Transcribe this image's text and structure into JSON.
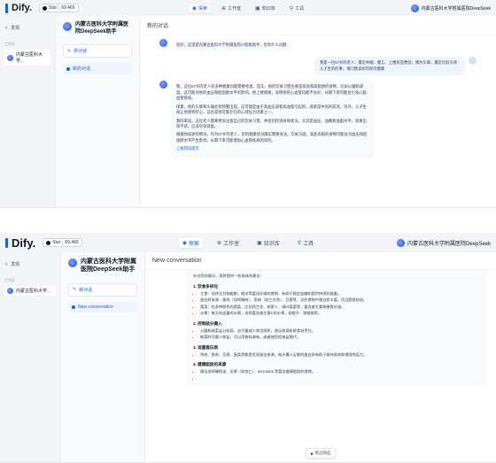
{
  "brand": "Dify.",
  "github": {
    "label": "Star",
    "count": "69,469"
  },
  "nav": [
    {
      "label": "探索",
      "icon": "explore-icon"
    },
    {
      "label": "工作室",
      "icon": "studio-icon"
    },
    {
      "label": "知识库",
      "icon": "knowledge-icon"
    },
    {
      "label": "工具",
      "icon": "tools-icon"
    }
  ],
  "user_name": "内蒙古医科大学附属医院DeepSeek",
  "sidebar": {
    "explore": "发现",
    "workspace_section": "工作区",
    "workspace_item_short": "内蒙古医科大学...",
    "workspace_item": "内蒙古医科大学..."
  },
  "app_name": "内蒙古医科大学附属医院DeepSeek助手",
  "new_chat": "新对话",
  "conv_cn": "新的对话",
  "conv_en": "New conversation",
  "title_cn": "新的对话",
  "title_en": "New conversation",
  "chat": {
    "greeting": "您好，这里是内蒙古医科大学附属医院AI智能助手，您有什么问题",
    "user_msg": "我是一位67岁的老人，最近失眠、健忘、上楼有些费劲，偶尔头晕，最近比较头疼儿子生的的事，请问我该如何保持健康",
    "reply_p1": "嗯，这位67岁的老人有多种健康问题需要考虑。首先，他的饮食习惯主要是高盐和高脂肪的食物，比如火腿和咸菜。这可能对他的血压和胆固醇水平有影响。他上楼困难，说明他的心血管功能不太好，长期下来可能会引发心脑血管疾病。",
    "reply_p2": "接着，他的头晕和头痛症状频繁出现，这可能是由于高血压或者高血脂引起的，或者是中风的前兆。另外，儿子生病让他感到担心，这也是他可能存在的心理压力因素之一。",
    "reply_p3": "我的来说，这位老人需要更加注意自己的饮食习惯，并密切检测身体状况，尤其是血压、血糖和血脂水平。如果出现不适，应该尽早就医。",
    "reply_p4": "根据你描述的情况，作为67岁的老人，您的健康状况确实需要关注。饮食方面，高盐高脂的食物可能会对血压和胆固醇水平产生影响，长期下来可能增加心血管疾病的风险。",
    "reply_more": "上报错误提示",
    "long_intro": "针对您的情况，我将提供一些具体的建议：",
    "sec1": "1. 饮食多样化",
    "sec1_items": [
      "主食：选择全谷物粗粮，糙米等富含纤维的食物，有助于稳定血糖和提供持续的能量。",
      "蛋白质来源：瘦肉（如鸡胸肉）、鱼肉（如三文鱼）、豆腐等，这些食物中蛋白质丰富，而且脂肪较低。",
      "蔬菜：吃多种颜色的蔬菜，比如西兰花、胡萝卜、绿叶蔬菜等，富含维生素和膳食纤维。",
      "水果：每天吃适量的水果，选择富含维生素C的水果，如橙子、猕猴桃等。"
    ],
    "sec2": "2. 控制盐分摄入",
    "sec2_items": [
      "火腿和咸菜盐分较高，应尽量减少食用频率，建议改用新鲜食材烹饪。",
      "做菜时尽量少放盐，可以用香料调味，或者使用低钠盐替代。"
    ],
    "sec3": "3. 适量蛋白质",
    "sec3_items": [
      "鸡肉、鱼肉、豆腐、蛋类等都是优质蛋白来源，每天摄入足够的蛋白质有助于维持肌肉和增强免疫力。"
    ],
    "sec4": "4. 健康脂肪的来源",
    "sec4_items": [
      "建议选择橄榄油、坚果（如杏仁）、avocados 等富含健康脂肪的食物。"
    ],
    "stop": "停止响应"
  }
}
